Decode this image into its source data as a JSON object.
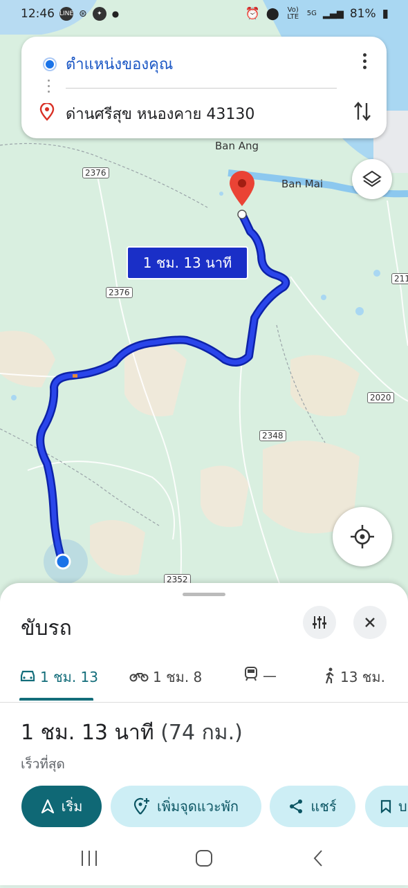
{
  "status_bar": {
    "time": "12:46",
    "app_icons": [
      "LINE",
      "messenger-icon"
    ],
    "volte": "Vo) LTE",
    "network": "5G",
    "battery": "81%"
  },
  "search": {
    "origin": "ตำแหน่งของคุณ",
    "destination": "ด่านศรีสุข หนองคาย 43130"
  },
  "map": {
    "place_labels": [
      "Ban Ang",
      "Ban Mai"
    ],
    "road_shields": [
      "2376",
      "2376",
      "2348",
      "2020",
      "2352",
      "211"
    ],
    "route_label": "1 ชม. 13 นาที",
    "colors": {
      "route": "#1e35d6",
      "route_casing": "#0d22a8",
      "pin": "#ea4335",
      "origin": "#1a73e8"
    }
  },
  "sheet": {
    "title": "ขับรถ",
    "tabs": [
      {
        "icon": "car-icon",
        "label": "1 ชม. 13"
      },
      {
        "icon": "motorcycle-icon",
        "label": "1 ชม. 8"
      },
      {
        "icon": "train-icon",
        "label": "—"
      },
      {
        "icon": "walk-icon",
        "label": "13 ชม."
      }
    ],
    "duration": "1 ชม. 13 นาที",
    "distance": "(74 กม.)",
    "subtitle": "เร็วที่สุด",
    "actions": {
      "start": "เริ่ม",
      "add_stop": "เพิ่มจุดแวะพัก",
      "share": "แชร์",
      "save": "บ"
    }
  }
}
